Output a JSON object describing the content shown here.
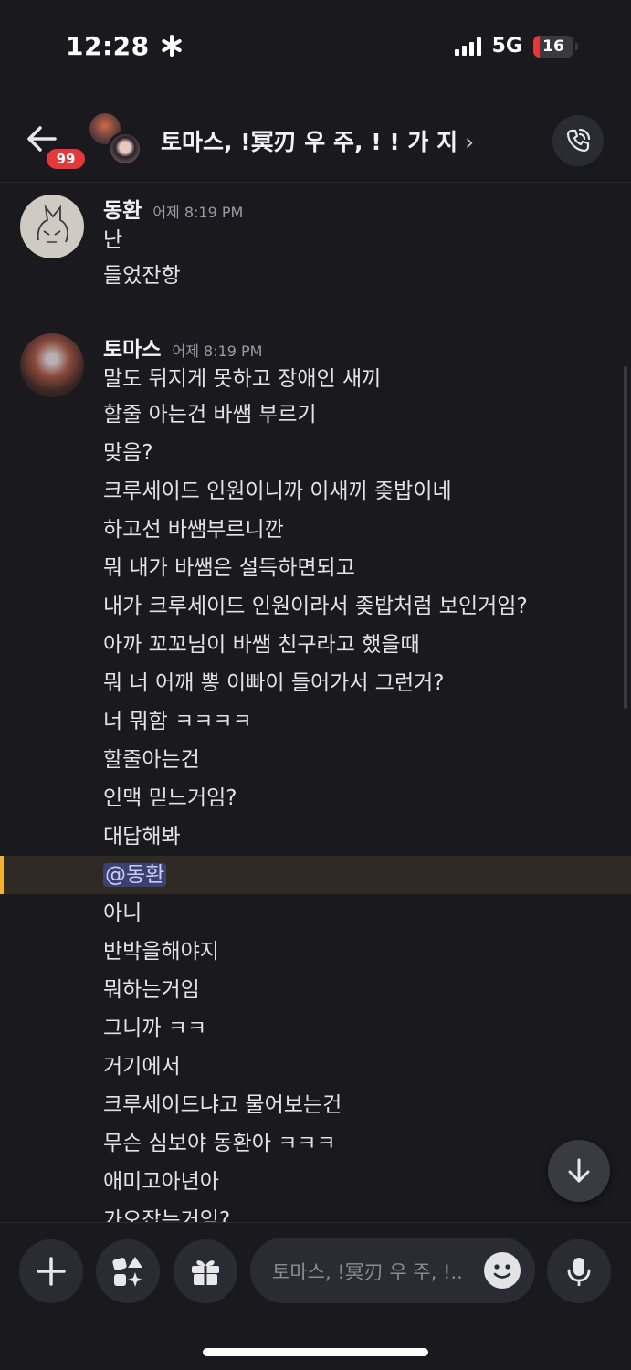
{
  "status_bar": {
    "time": "12:28",
    "focus_icon": "asterisk-icon",
    "network": "5G",
    "battery_level": "16",
    "battery_fraction": 0.16
  },
  "header": {
    "back_icon": "arrow-left-icon",
    "unread_badge": "99",
    "title": "토마스, !冥刃 우 주, ! ! 가 지",
    "title_chevron": "›",
    "call_icon": "phone-call-icon",
    "colors": {
      "badge": "#e5383b"
    }
  },
  "messages": [
    {
      "author": "동환",
      "time": "어제 8:19 PM",
      "lines": [
        "난",
        "들었잔항"
      ]
    },
    {
      "author": "토마스",
      "time": "어제 8:19 PM",
      "lines": [
        "말도 뒤지게 못하고 장애인 새끼",
        "할줄 아는건 바쌤 부르기",
        "맞음?",
        "크루세이드 인원이니까 이새끼 좆밥이네",
        "하고선 바쌤부르니깐",
        "뭐 내가 바쌤은 설득하면되고",
        "내가 크루세이드 인원이라서 좆밥처럼 보인거임?",
        "아까 꼬꼬님이 바쌤 친구라고 했을때",
        "뭐 너 어깨 뽕 이빠이 들어가서 그런거?",
        "너 뭐함 ㅋㅋㅋㅋ",
        "할줄아는건",
        "인맥 믿느거임?",
        "대답해봐",
        "@동환",
        "아니",
        "반박을해야지",
        "뭐하는거임",
        "그니까 ㅋㅋ",
        "거기에서",
        "크루세이드냐고 물어보는건",
        "무슨 심보야 동환아 ㅋㅋㅋ",
        "애미고아년아",
        "가오잡는거임?"
      ],
      "highlight_color": "#f0b232",
      "mention_color": "#3c4270"
    }
  ],
  "scroll_down_icon": "arrow-down-icon",
  "composer": {
    "plus_icon": "plus-icon",
    "apps_icon": "apps-icon",
    "gift_icon": "gift-icon",
    "placeholder": "토마스, !冥刃 우 주, !..",
    "emoji_icon": "emoji-smile-icon",
    "mic_icon": "microphone-icon"
  }
}
